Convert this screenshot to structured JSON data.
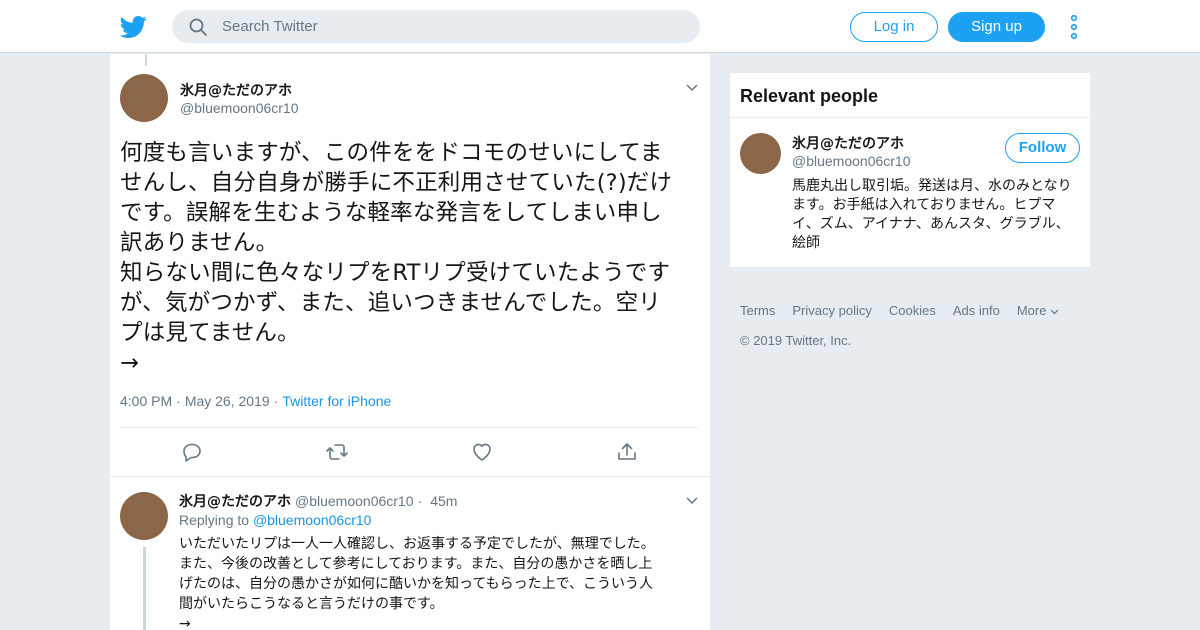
{
  "colors": {
    "brand": "#1da1f2",
    "link": "#1b95e0",
    "secondary_text": "#657786",
    "background": "#e6ecf0",
    "avatar": "#8b6648"
  },
  "header": {
    "logo_icon": "twitter-bird-icon",
    "search_placeholder": "Search Twitter",
    "login_label": "Log in",
    "signup_label": "Sign up",
    "more_icon": "vertical-dots-icon"
  },
  "tweet": {
    "author_name": "氷月@ただのアホ",
    "author_handle": "@bluemoon06cr10",
    "text": "何度も言いますが、この件ををドコモのせいにしてま\nせんし、自分自身が勝手に不正利用させていた(?)だけ\nです。誤解を生むような軽率な発言をしてしまい申し\n訳ありません。\n知らない間に色々なリプをRTリプ受けていたようです\nが、気がつかず、また、追いつきませんでした。空リ\nプは見てません。\n→",
    "time": "4:00 PM",
    "date": "May 26, 2019",
    "source": "Twitter for iPhone",
    "actions": [
      "reply-icon",
      "retweet-icon",
      "like-icon",
      "share-icon"
    ]
  },
  "reply": {
    "author_name": "氷月@ただのアホ",
    "author_handle": "@bluemoon06cr10",
    "age": "45m",
    "replying_prefix": "Replying to",
    "replying_handle": "@bluemoon06cr10",
    "text": "いただいたリプは一人一人確認し、お返事する予定でしたが、無理でした。\nまた、今後の改善として参考にしております。また、自分の愚かさを晒し上\nげたのは、自分の愚かさが如何に酷いかを知ってもらった上で、こういう人\n間がいたらこうなると言うだけの事です。\n→"
  },
  "sidebar": {
    "title": "Relevant people",
    "person": {
      "name": "氷月@ただのアホ",
      "handle": "@bluemoon06cr10",
      "follow_label": "Follow",
      "bio": "馬鹿丸出し取引垢。発送は月、水のみとなります。お手紙は入れておりません。ヒプマイ、ズム、アイナナ、あんスタ、グラブル、絵師"
    }
  },
  "footer": {
    "links": [
      "Terms",
      "Privacy policy",
      "Cookies",
      "Ads info",
      "More"
    ],
    "copyright": "© 2019 Twitter, Inc."
  }
}
